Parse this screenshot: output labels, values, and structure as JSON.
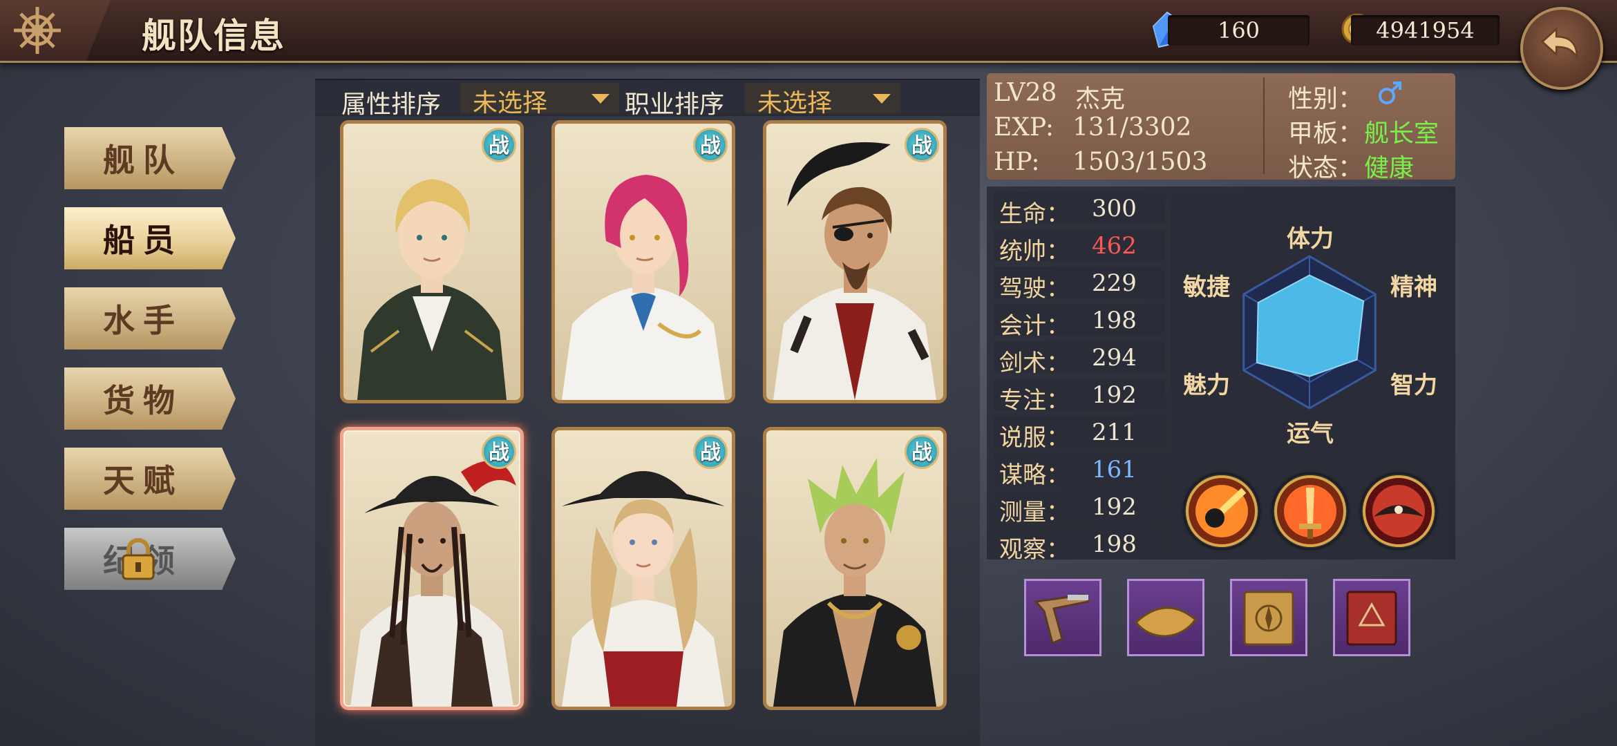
{
  "header": {
    "title": "舰队信息",
    "gems": "160",
    "gold": "4941954"
  },
  "menu": {
    "items": [
      {
        "label": "舰队"
      },
      {
        "label": "船员"
      },
      {
        "label": "水手"
      },
      {
        "label": "货物"
      },
      {
        "label": "天赋"
      },
      {
        "label": "纪领"
      }
    ],
    "active_index": 1,
    "locked_index": 5
  },
  "filters": {
    "attr_label": "属性排序",
    "attr_value": "未选择",
    "job_label": "职业排序",
    "job_value": "未选择"
  },
  "crew": {
    "badge": "战",
    "selected_index": 3,
    "cards": [
      {
        "portrait": "blonde-officer"
      },
      {
        "portrait": "pink-hair-officer"
      },
      {
        "portrait": "eyepatch-pirate"
      },
      {
        "portrait": "tricorn-pirate"
      },
      {
        "portrait": "pirate-woman"
      },
      {
        "portrait": "green-hair-pirate"
      }
    ]
  },
  "character": {
    "level": "LV28",
    "name": "杰克",
    "exp_label": "EXP:",
    "exp_value": "131/3302",
    "hp_label": "HP:",
    "hp_value": "1503/1503",
    "gender_label": "性别：",
    "gender_icon": "male-icon",
    "deck_label": "甲板：",
    "deck_value": "舰长室",
    "status_label": "状态：",
    "status_value": "健康"
  },
  "stats": [
    {
      "label": "生命：",
      "value": "300",
      "tone": "normal"
    },
    {
      "label": "统帅：",
      "value": "462",
      "tone": "red"
    },
    {
      "label": "驾驶：",
      "value": "229",
      "tone": "normal"
    },
    {
      "label": "会计：",
      "value": "198",
      "tone": "normal"
    },
    {
      "label": "剑术：",
      "value": "294",
      "tone": "normal"
    },
    {
      "label": "专注：",
      "value": "192",
      "tone": "normal"
    },
    {
      "label": "说服：",
      "value": "211",
      "tone": "normal"
    },
    {
      "label": "谋略：",
      "value": "161",
      "tone": "blue"
    },
    {
      "label": "测量：",
      "value": "192",
      "tone": "normal"
    },
    {
      "label": "观察：",
      "value": "198",
      "tone": "normal"
    }
  ],
  "radar": {
    "labels": [
      "体力",
      "精神",
      "智力",
      "运气",
      "魅力",
      "敏捷"
    ],
    "values": [
      0.75,
      0.82,
      0.72,
      0.58,
      0.8,
      0.78
    ],
    "fill_color": "#4cb9e6"
  },
  "skills": [
    "fire-cannonball-icon",
    "flaming-sword-icon",
    "pirate-hat-flame-icon"
  ],
  "equipment": [
    "flintlock-pistol-icon",
    "tricorn-hat-icon",
    "compass-book-icon",
    "red-tome-icon"
  ],
  "colors": {
    "accent_gold": "#e9b85a",
    "stat_red": "#ff5656",
    "stat_blue": "#7fb7ff",
    "status_green": "#79ef4b"
  }
}
